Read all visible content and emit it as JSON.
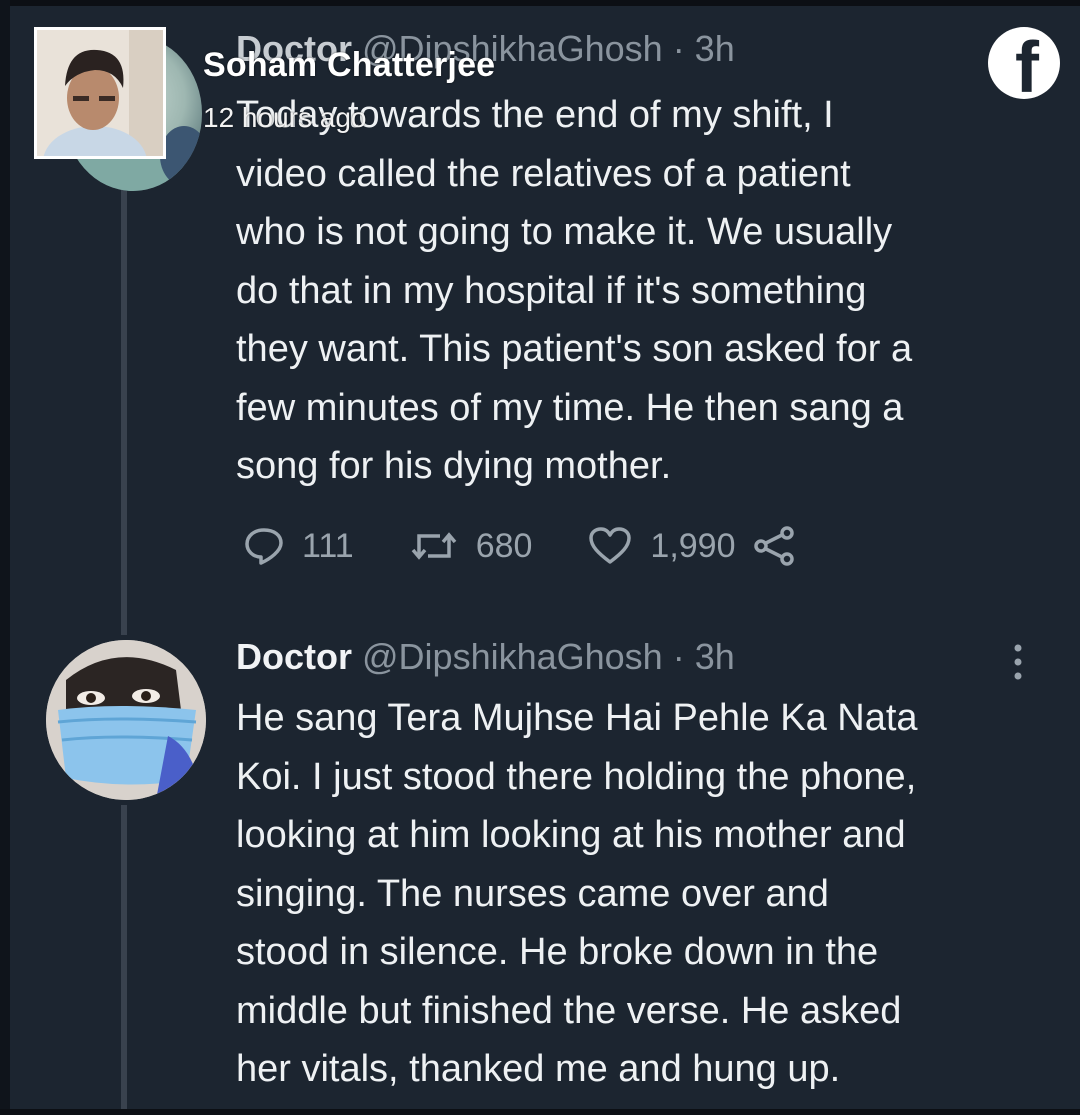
{
  "fb_post": {
    "author_name": "Soham Chatterjee",
    "posted_time": "12 hours ago",
    "app_icon": "facebook-icon"
  },
  "tweet1": {
    "header_partial": "@DipshikhaGhosh · 3h",
    "lines": [
      "Today towards the end of my shift, I",
      "video called the relatives of a patient",
      "who is not going to make it. We usually",
      "do that in my hospital if it's something",
      "they want. This patient's son asked for a",
      "few minutes of my time. He then sang a",
      "song for his dying mother."
    ],
    "replies": "111",
    "retweets": "680",
    "likes": "1,990"
  },
  "tweet2": {
    "display_name": "Doctor",
    "handle": "@DipshikhaGhosh",
    "time": "· 3h",
    "lines": [
      "He sang Tera Mujhse Hai Pehle Ka Nata",
      "Koi. I just stood there holding the phone,",
      "looking at him looking at his mother and",
      "singing. The nurses came over and",
      "stood in silence. He broke down in the",
      "middle but finished the verse. He asked",
      "her vitals, thanked me and hung up."
    ]
  },
  "icons": {
    "reply": "reply-icon",
    "retweet": "retweet-icon",
    "like": "heart-icon",
    "share": "share-icon",
    "more": "more-vertical-icon"
  }
}
